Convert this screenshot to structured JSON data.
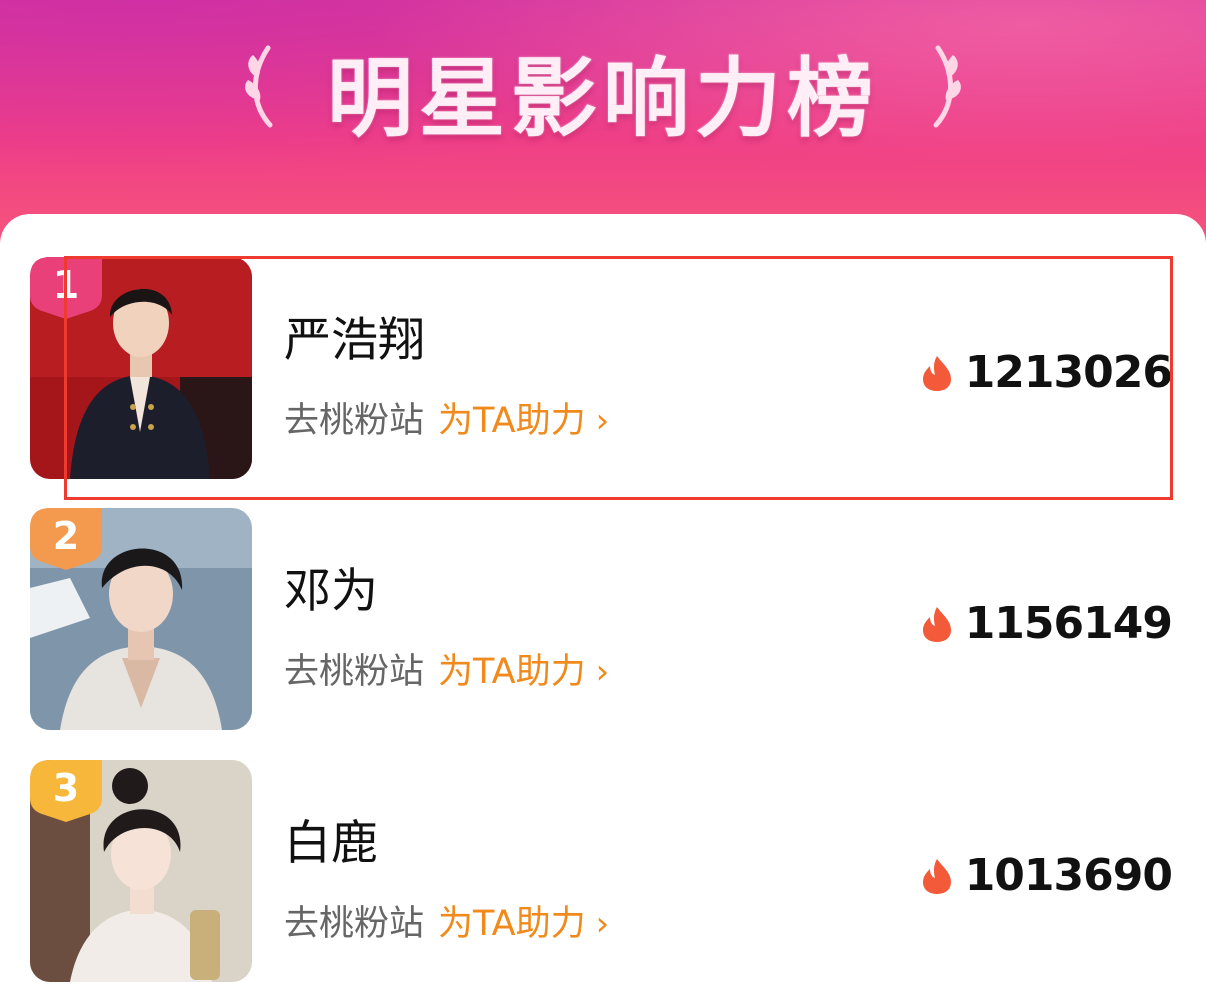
{
  "header": {
    "title": "明星影响力榜"
  },
  "colors": {
    "accent_orange": "#f08a1c",
    "rank1_badge": "#e9407a",
    "rank2_badge": "#f39a4e",
    "rank3_badge": "#f7b73b",
    "highlight_border": "#ee3a2f",
    "flame": "#f25a3a"
  },
  "leaderboard": {
    "items": [
      {
        "rank": "1",
        "name": "严浩翔",
        "link_prefix": "去桃粉站",
        "link_action": "为TA助力",
        "chevron": "›",
        "score": "1213026",
        "icon": "flame-icon"
      },
      {
        "rank": "2",
        "name": "邓为",
        "link_prefix": "去桃粉站",
        "link_action": "为TA助力",
        "chevron": "›",
        "score": "1156149",
        "icon": "flame-icon"
      },
      {
        "rank": "3",
        "name": "白鹿",
        "link_prefix": "去桃粉站",
        "link_action": "为TA助力",
        "chevron": "›",
        "score": "1013690",
        "icon": "flame-icon"
      }
    ]
  }
}
